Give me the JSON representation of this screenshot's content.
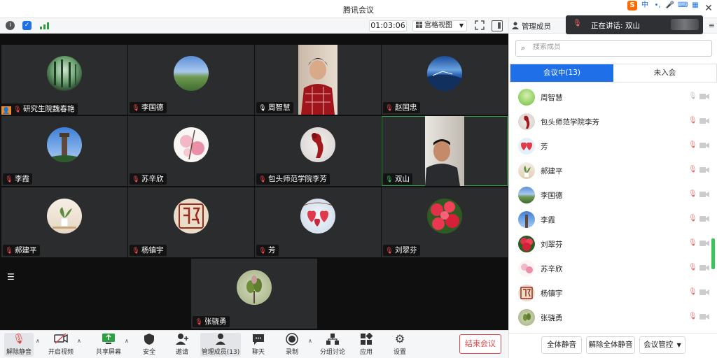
{
  "window": {
    "title": "腾讯会议"
  },
  "ime": {
    "lang": "中",
    "punct": "•,",
    "mic": "🎤",
    "keyboard": "⌨",
    "grid": "▦"
  },
  "infobar": {
    "timer": "01:03:06",
    "view_mode": "宫格视图"
  },
  "tiles": [
    {
      "name": "研究生院魏春艳",
      "mic": "muted",
      "avatar": "forest",
      "host": true
    },
    {
      "name": "李国德",
      "mic": "muted",
      "avatar": "sky"
    },
    {
      "name": "周智慧",
      "mic": "on",
      "avatar": "video-woman"
    },
    {
      "name": "赵国忠",
      "mic": "muted",
      "avatar": "lake"
    },
    {
      "name": "李霞",
      "mic": "muted",
      "avatar": "tower"
    },
    {
      "name": "苏辛欣",
      "mic": "muted",
      "avatar": "blossom"
    },
    {
      "name": "包头师范学院李芳",
      "mic": "muted",
      "avatar": "red-sculpture"
    },
    {
      "name": "双山",
      "mic": "speaking",
      "avatar": "video-man"
    },
    {
      "name": "郝建平",
      "mic": "muted",
      "avatar": "plant"
    },
    {
      "name": "杨镇宇",
      "mic": "muted",
      "avatar": "seal"
    },
    {
      "name": "芳",
      "mic": "muted",
      "avatar": "hearts"
    },
    {
      "name": "刘翠芬",
      "mic": "muted",
      "avatar": "roses"
    },
    {
      "name": "张骁勇",
      "mic": "muted",
      "avatar": "buds"
    }
  ],
  "toolbar": {
    "unmute": "解除静音",
    "video": "开启视频",
    "share": "共享屏幕",
    "security": "安全",
    "invite": "邀请",
    "members": "管理成员(13)",
    "chat": "聊天",
    "record": "录制",
    "breakout": "分组讨论",
    "apps": "应用",
    "settings": "设置",
    "end": "结束会议"
  },
  "panel": {
    "title": "管理成员",
    "speaking_label": "正在讲话: 双山",
    "search_placeholder": "搜索成员",
    "tab_in": "会议中(13)",
    "tab_out": "未入会",
    "members": [
      {
        "name": "周智慧",
        "mic": "on",
        "avatar": "green"
      },
      {
        "name": "包头师范学院李芳",
        "mic": "muted",
        "avatar": "red-sculpture"
      },
      {
        "name": "芳",
        "mic": "muted",
        "avatar": "hearts"
      },
      {
        "name": "郝建平",
        "mic": "muted",
        "avatar": "plant"
      },
      {
        "name": "李国德",
        "mic": "muted",
        "avatar": "sky"
      },
      {
        "name": "李霞",
        "mic": "muted",
        "avatar": "tower"
      },
      {
        "name": "刘翠芬",
        "mic": "muted",
        "avatar": "roses"
      },
      {
        "name": "苏辛欣",
        "mic": "muted",
        "avatar": "blossom"
      },
      {
        "name": "杨镇宇",
        "mic": "muted",
        "avatar": "seal"
      },
      {
        "name": "张骁勇",
        "mic": "muted",
        "avatar": "buds"
      }
    ],
    "mute_all": "全体静音",
    "unmute_all": "解除全体静音",
    "control": "会议管控"
  }
}
